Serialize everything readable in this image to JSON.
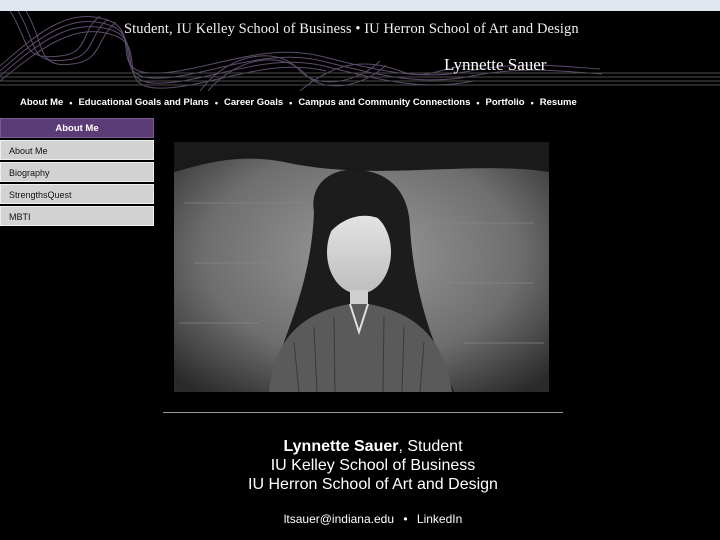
{
  "header": {
    "tagline": "Student, IU Kelley School of Business • IU Herron School of Art and Design",
    "site_name": "Lynnette Sauer"
  },
  "nav": {
    "items": [
      "About Me",
      "Educational Goals and Plans",
      "Career Goals",
      "Campus and Community Connections",
      "Portfolio",
      "Resume"
    ],
    "separator": "•"
  },
  "sidebar": {
    "heading": "About Me",
    "items": [
      "About Me",
      "Biography",
      "StrengthsQuest",
      "MBTI"
    ]
  },
  "footer": {
    "name": "Lynnette Sauer",
    "role": ", Student",
    "line2": "IU Kelley School of Business",
    "line3": "IU Herron School of Art and Design",
    "email": "ltsauer@indiana.edu",
    "separator": "•",
    "linkedin": "LinkedIn"
  },
  "colors": {
    "background": "#000000",
    "sidebar_heading": "#5b3c77",
    "sidebar_item": "#d2d2d2"
  }
}
